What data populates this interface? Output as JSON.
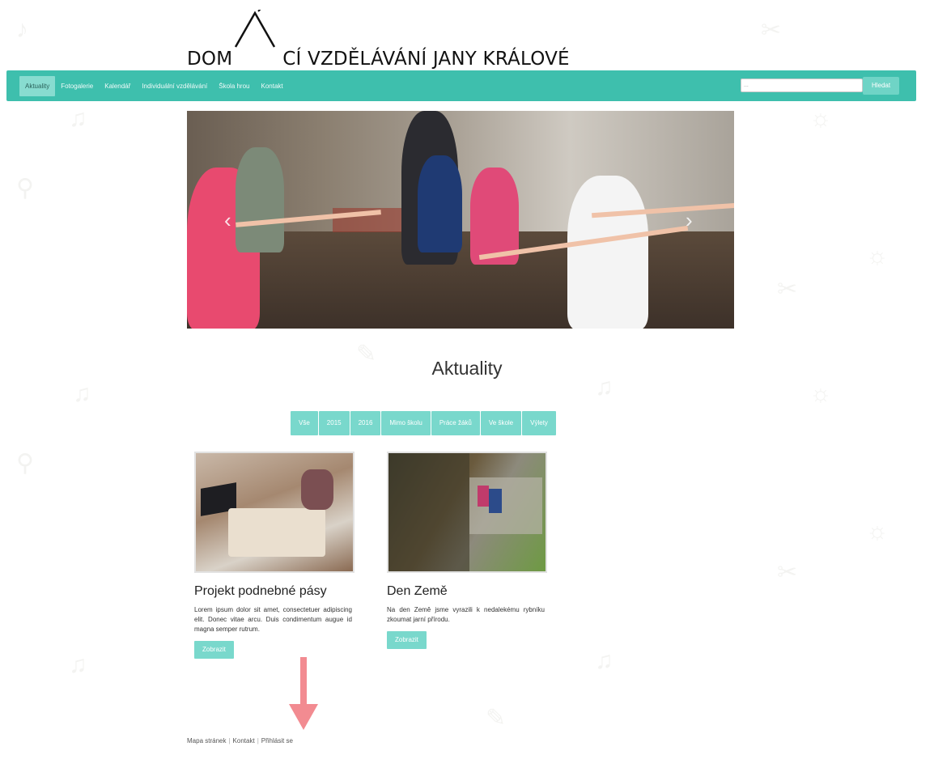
{
  "site": {
    "logo_text": "DOMÁCÍ VZDĚLÁVÁNÍ JANY KRÁLOVÉ",
    "logo_part1": "DOM",
    "logo_part2": "CÍ VZDĚLÁVÁNÍ JANY KRÁLOVÉ",
    "accent_color": "#3ebfad",
    "button_color": "#79d8cc"
  },
  "nav": {
    "items": [
      "Aktuality",
      "Fotogalerie",
      "Kalendář",
      "Individuální vzdělávání",
      "Škola hrou",
      "Kontakt"
    ],
    "active": "Aktuality"
  },
  "search": {
    "placeholder": "...",
    "button_label": "Hledat"
  },
  "hero": {
    "image": "photo-children-yoga-pose",
    "prev_icon": "chevron-left-icon",
    "next_icon": "chevron-right-icon"
  },
  "main": {
    "title": "Aktuality",
    "filters": [
      "Vše",
      "2015",
      "2016",
      "Mimo školu",
      "Práce žáků",
      "Ve škole",
      "Výlety"
    ]
  },
  "articles": [
    {
      "title": "Projekt podnebné pásy",
      "excerpt": "Lorem ipsum dolor sit amet, consectetuer adipiscing elit. Donec vitae arcu. Duis condimentum augue id magna semper rutrum.",
      "button": "Zobrazit",
      "image": "photo-girl-working-on-floor"
    },
    {
      "title": "Den Země",
      "excerpt": "Na den Země jsme vyrazili k nedalekému rybníku zkoumat jarní přírodu.",
      "button": "Zobrazit",
      "image": "photo-children-by-pond"
    }
  ],
  "footer": {
    "links": [
      "Mapa stránek",
      "Kontakt",
      "Přihlásit se"
    ]
  },
  "annotation": {
    "arrow_color": "#f28b91",
    "icon": "arrow-down-icon"
  }
}
